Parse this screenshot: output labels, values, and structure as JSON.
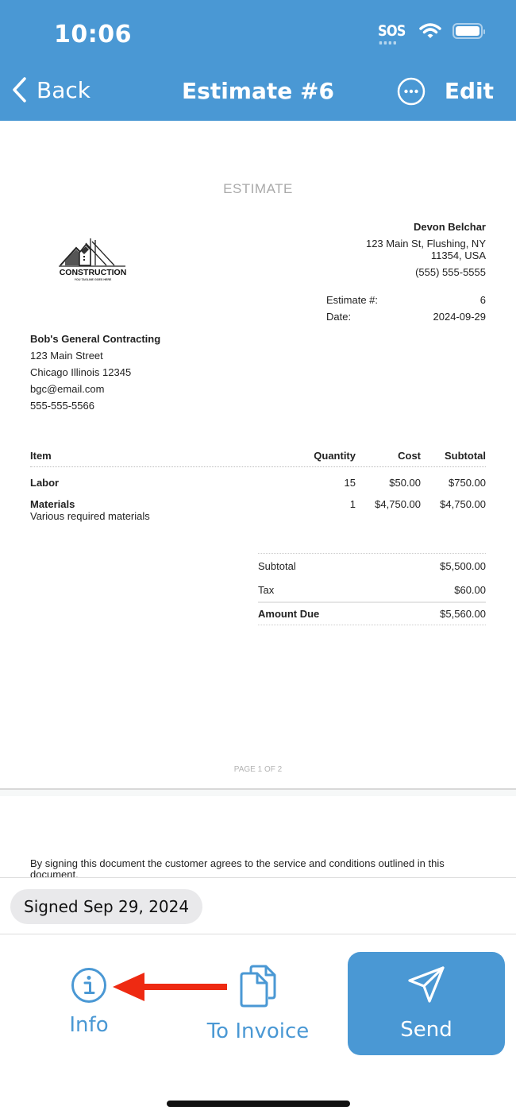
{
  "status_bar": {
    "time": "10:06",
    "sos": "SOS"
  },
  "nav": {
    "back_label": "Back",
    "title": "Estimate #6",
    "edit_label": "Edit"
  },
  "document": {
    "title": "ESTIMATE",
    "logo": {
      "brand": "CONSTRUCTION",
      "tagline": "YOU TAGLINE GOES HERE"
    },
    "client": {
      "name": "Devon Belchar",
      "address_line1": "123 Main St, Flushing, NY",
      "address_line2": "11354, USA",
      "phone": "(555) 555-5555"
    },
    "meta": [
      {
        "label": "Estimate #:",
        "value": "6"
      },
      {
        "label": "Date:",
        "value": "2024-09-29"
      }
    ],
    "company": {
      "name": "Bob's General Contracting",
      "street": "123 Main Street",
      "city": "Chicago Illinois 12345",
      "email": "bgc@email.com",
      "phone": "555-555-5566"
    },
    "table": {
      "headers": {
        "item": "Item",
        "quantity": "Quantity",
        "cost": "Cost",
        "subtotal": "Subtotal"
      },
      "rows": [
        {
          "item": "Labor",
          "description": "",
          "quantity": "15",
          "cost": "$50.00",
          "subtotal": "$750.00"
        },
        {
          "item": "Materials",
          "description": "Various required materials",
          "quantity": "1",
          "cost": "$4,750.00",
          "subtotal": "$4,750.00"
        }
      ]
    },
    "totals": {
      "subtotal_label": "Subtotal",
      "subtotal": "$5,500.00",
      "tax_label": "Tax",
      "tax": "$60.00",
      "due_label": "Amount Due",
      "due": "$5,560.00"
    },
    "page_indicator": "PAGE 1 OF 2",
    "terms": "By signing this document the customer agrees to the service and conditions outlined in this document."
  },
  "signed_badge": "Signed Sep 29, 2024",
  "actions": {
    "info_label": "Info",
    "to_invoice_label": "To Invoice",
    "send_label": "Send"
  },
  "colors": {
    "accent": "#4a98d4",
    "annotation_arrow": "#ee2a12"
  }
}
